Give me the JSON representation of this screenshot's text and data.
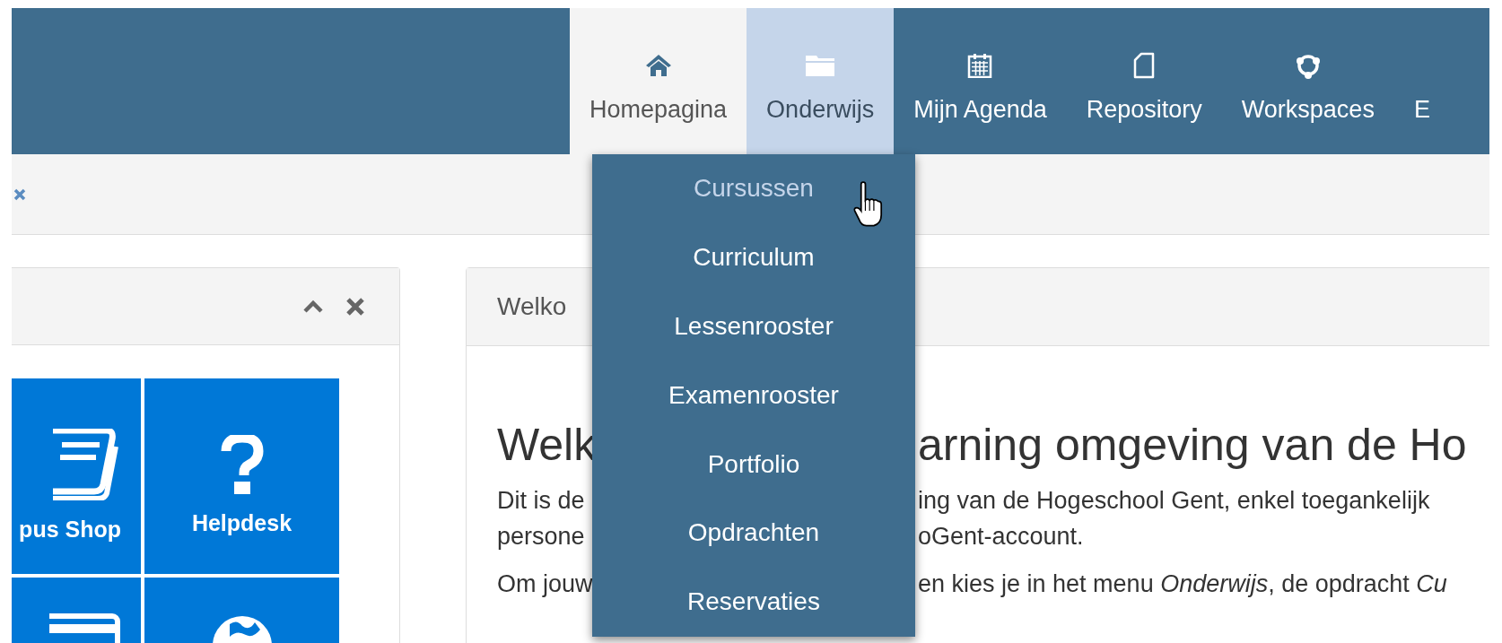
{
  "navbar": {
    "items": [
      {
        "label": "Homepagina",
        "selected": true,
        "expanded": false
      },
      {
        "label": "Onderwijs",
        "selected": false,
        "expanded": true
      },
      {
        "label": "Mijn Agenda",
        "selected": false,
        "expanded": false
      },
      {
        "label": "Repository",
        "selected": false,
        "expanded": false
      },
      {
        "label": "Workspaces",
        "selected": false,
        "expanded": false
      },
      {
        "label": "E",
        "selected": false,
        "expanded": false
      }
    ]
  },
  "dropdown": {
    "items": [
      {
        "label": "Cursussen",
        "hovered": true
      },
      {
        "label": "Curriculum",
        "hovered": false
      },
      {
        "label": "Lessenrooster",
        "hovered": false
      },
      {
        "label": "Examenrooster",
        "hovered": false
      },
      {
        "label": "Portfolio",
        "hovered": false
      },
      {
        "label": "Opdrachten",
        "hovered": false
      },
      {
        "label": "Reservaties",
        "hovered": false
      }
    ]
  },
  "tiles": [
    {
      "label": "pus Shop"
    },
    {
      "label": "Helpdesk"
    }
  ],
  "welcome_panel": {
    "header": "Welko",
    "heading": {
      "left": "Welk",
      "right": "arning omgeving van de Ho"
    },
    "paragraphs": [
      {
        "lines": [
          {
            "left": "Dit is de",
            "right": "ing van de Hogeschool Gent, enkel toegankelijk"
          },
          {
            "left": "persone",
            "right": "oGent-account."
          }
        ]
      },
      {
        "lines": [
          {
            "left": "Om jouw",
            "right": "en kies je in het menu *Onderwijs*, de opdracht *Cu*"
          }
        ]
      }
    ]
  }
}
